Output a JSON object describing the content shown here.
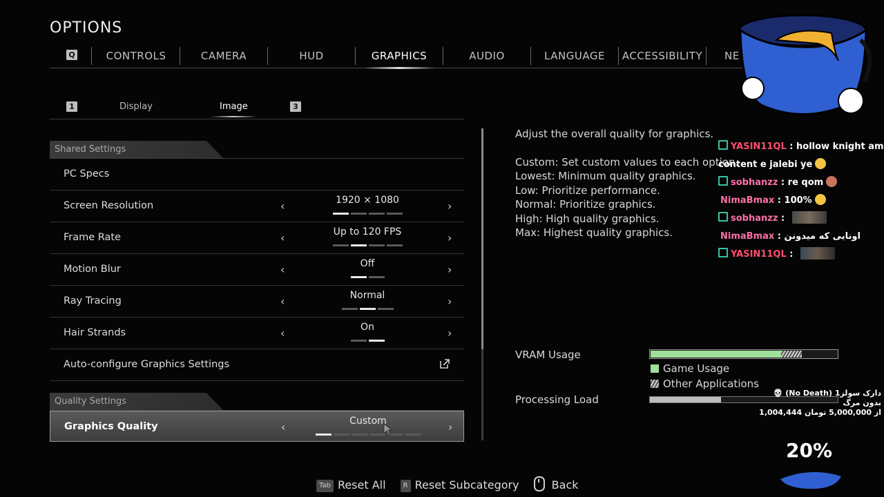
{
  "title": "OPTIONS",
  "tabs": {
    "key_left": "Q",
    "items": [
      "CONTROLS",
      "CAMERA",
      "HUD",
      "GRAPHICS",
      "AUDIO",
      "LANGUAGE",
      "ACCESSIBILITY",
      "NE"
    ],
    "active": "GRAPHICS"
  },
  "subtabs": {
    "key_left": "1",
    "key_right": "3",
    "display": "Display",
    "image": "Image",
    "active": "Image"
  },
  "shared_settings": {
    "header": "Shared Settings",
    "rows": [
      {
        "label": "PC Specs",
        "value": null
      },
      {
        "label": "Screen Resolution",
        "value": "1920 × 1080",
        "level": 1,
        "steps": 4
      },
      {
        "label": "Frame Rate",
        "value": "Up to 120 FPS",
        "level": 2,
        "steps": 4
      },
      {
        "label": "Motion Blur",
        "value": "Off",
        "level": 1,
        "steps": 2
      },
      {
        "label": "Ray Tracing",
        "value": "Normal",
        "level": 2,
        "steps": 3
      },
      {
        "label": "Hair Strands",
        "value": "On",
        "level": 2,
        "steps": 2
      },
      {
        "label": "Auto-configure Graphics Settings",
        "value": null
      }
    ]
  },
  "quality_settings": {
    "header": "Quality Settings",
    "rows": [
      {
        "label": "Graphics Quality",
        "value": "Custom",
        "level": 1,
        "steps": 6
      }
    ]
  },
  "description": {
    "title": "Adjust the overall quality for graphics.",
    "lines": [
      "Custom: Set custom values to each option.",
      "Lowest: Minimum quality graphics.",
      "Low: Prioritize performance.",
      "Normal: Prioritize graphics.",
      "High: High quality graphics.",
      "Max: Highest quality graphics."
    ]
  },
  "vram": {
    "label": "VRAM Usage",
    "game_fraction": 0.7,
    "other_fraction": 0.11,
    "legend_game": "Game Usage",
    "legend_other": "Other Applications",
    "game_color": "#9fe09a"
  },
  "processing": {
    "label": "Processing Load",
    "fraction": 0.38
  },
  "hints": {
    "reset_all_key": "Tab",
    "reset_all": "Reset All",
    "reset_sub_key": "R",
    "reset_sub": "Reset Subcategory",
    "back": "Back"
  },
  "chat": [
    {
      "user": "YASIN11QL",
      "message": "hollow knight am",
      "badge": true,
      "color": "red"
    },
    {
      "user": "",
      "message": "content e jalebi ye",
      "badge": false,
      "emoji": true
    },
    {
      "user": "sobhanzz",
      "message": "re qom",
      "badge": true,
      "color": "pink",
      "emoji": true
    },
    {
      "user": "NimaBmax",
      "message": "100%",
      "badge": false,
      "color": "pink",
      "emoji": true
    },
    {
      "user": "sobhanzz",
      "message": "",
      "badge": true,
      "color": "pink",
      "thumb": true
    },
    {
      "user": "NimaBmax",
      "message": "اونایی که میدونن",
      "badge": false,
      "color": "pink"
    },
    {
      "user": "YASIN11QL",
      "message": "",
      "badge": true,
      "color": "red",
      "thumb": true
    }
  ],
  "donation": {
    "line1": "💀 (No Death) دارک سولز1 بدون مرگ",
    "line2": "1,004,444 از 5,000,000 تومان",
    "percent": "20%"
  },
  "colors": {
    "accent_text": "#ffffff",
    "chat_red": "#ff4d6d",
    "chat_pink": "#ff6fa8",
    "badge": "#35c4a6",
    "mascot_blue": "#2f5fd0"
  }
}
